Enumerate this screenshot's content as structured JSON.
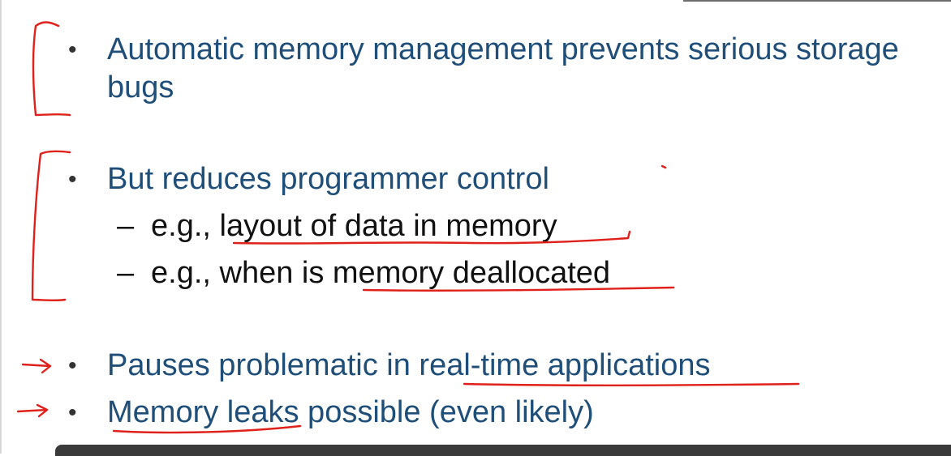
{
  "slide": {
    "bullets": [
      {
        "text": "Automatic memory management prevents serious storage bugs"
      },
      {
        "text": "But reduces programmer control"
      },
      {
        "text": "Pauses problematic in real-time applications"
      },
      {
        "text": "Memory leaks possible (even likely)"
      }
    ],
    "subbullets": [
      {
        "dash": "–",
        "text": "e.g., layout of data in memory"
      },
      {
        "dash": "–",
        "text": "e.g., when is memory deallocated"
      }
    ],
    "bullet_symbol": "•"
  },
  "colors": {
    "bullet_text": "#1f4e79",
    "sub_text": "#111111",
    "annotation_ink": "#e0201a"
  }
}
